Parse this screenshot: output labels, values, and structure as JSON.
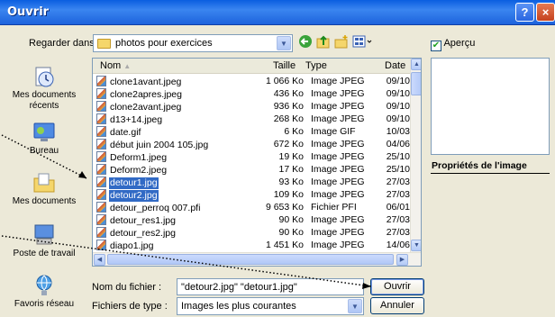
{
  "window": {
    "title": "Ouvrir"
  },
  "titlebar": {
    "help": "?",
    "close": "×"
  },
  "lookin": {
    "label": "Regarder dans :",
    "value": "photos pour exercices"
  },
  "preview": {
    "label": "Aperçu",
    "props_title": "Propriétés de l'image"
  },
  "places": [
    {
      "label": "Mes documents récents",
      "icon": "recent-documents-icon"
    },
    {
      "label": "Bureau",
      "icon": "desktop-icon"
    },
    {
      "label": "Mes documents",
      "icon": "my-documents-icon"
    },
    {
      "label": "Poste de travail",
      "icon": "my-computer-icon"
    },
    {
      "label": "Favoris réseau",
      "icon": "network-places-icon"
    }
  ],
  "columns": {
    "name": "Nom",
    "size": "Taille",
    "type": "Type",
    "date": "Date"
  },
  "files": [
    {
      "name": "clone1avant.jpeg",
      "size": "1 066 Ko",
      "type": "Image JPEG",
      "date": "09/10",
      "selected": false
    },
    {
      "name": "clone2apres.jpeg",
      "size": "436 Ko",
      "type": "Image JPEG",
      "date": "09/10",
      "selected": false
    },
    {
      "name": "clone2avant.jpeg",
      "size": "936 Ko",
      "type": "Image JPEG",
      "date": "09/10",
      "selected": false
    },
    {
      "name": "d13+14.jpeg",
      "size": "268 Ko",
      "type": "Image JPEG",
      "date": "09/10",
      "selected": false
    },
    {
      "name": "date.gif",
      "size": "6 Ko",
      "type": "Image GIF",
      "date": "10/03",
      "selected": false
    },
    {
      "name": "début juin 2004 105.jpg",
      "size": "672 Ko",
      "type": "Image JPEG",
      "date": "04/06",
      "selected": false
    },
    {
      "name": "Deform1.jpeg",
      "size": "19 Ko",
      "type": "Image JPEG",
      "date": "25/10",
      "selected": false
    },
    {
      "name": "Deform2.jpeg",
      "size": "17 Ko",
      "type": "Image JPEG",
      "date": "25/10",
      "selected": false
    },
    {
      "name": "detour1.jpg",
      "size": "93 Ko",
      "type": "Image JPEG",
      "date": "27/03",
      "selected": true
    },
    {
      "name": "detour2.jpg",
      "size": "109 Ko",
      "type": "Image JPEG",
      "date": "27/03",
      "selected": true
    },
    {
      "name": "detour_perroq 007.pfi",
      "size": "9 653 Ko",
      "type": "Fichier PFI",
      "date": "06/01",
      "selected": false
    },
    {
      "name": "detour_res1.jpg",
      "size": "90 Ko",
      "type": "Image JPEG",
      "date": "27/03",
      "selected": false
    },
    {
      "name": "detour_res2.jpg",
      "size": "90 Ko",
      "type": "Image JPEG",
      "date": "27/03",
      "selected": false
    },
    {
      "name": "diapo1.jpg",
      "size": "1 451 Ko",
      "type": "Image JPEG",
      "date": "14/06",
      "selected": false
    }
  ],
  "filename": {
    "label": "Nom du fichier :",
    "value": "\"detour2.jpg\" \"detour1.jpg\""
  },
  "filetype": {
    "label": "Fichiers de type :",
    "value": "Images les plus courantes"
  },
  "buttons": {
    "open": "Ouvrir",
    "cancel": "Annuler"
  },
  "colors": {
    "title_bar": "#1d63dc",
    "selection": "#316ac5",
    "dialog_bg": "#ece9d8"
  }
}
